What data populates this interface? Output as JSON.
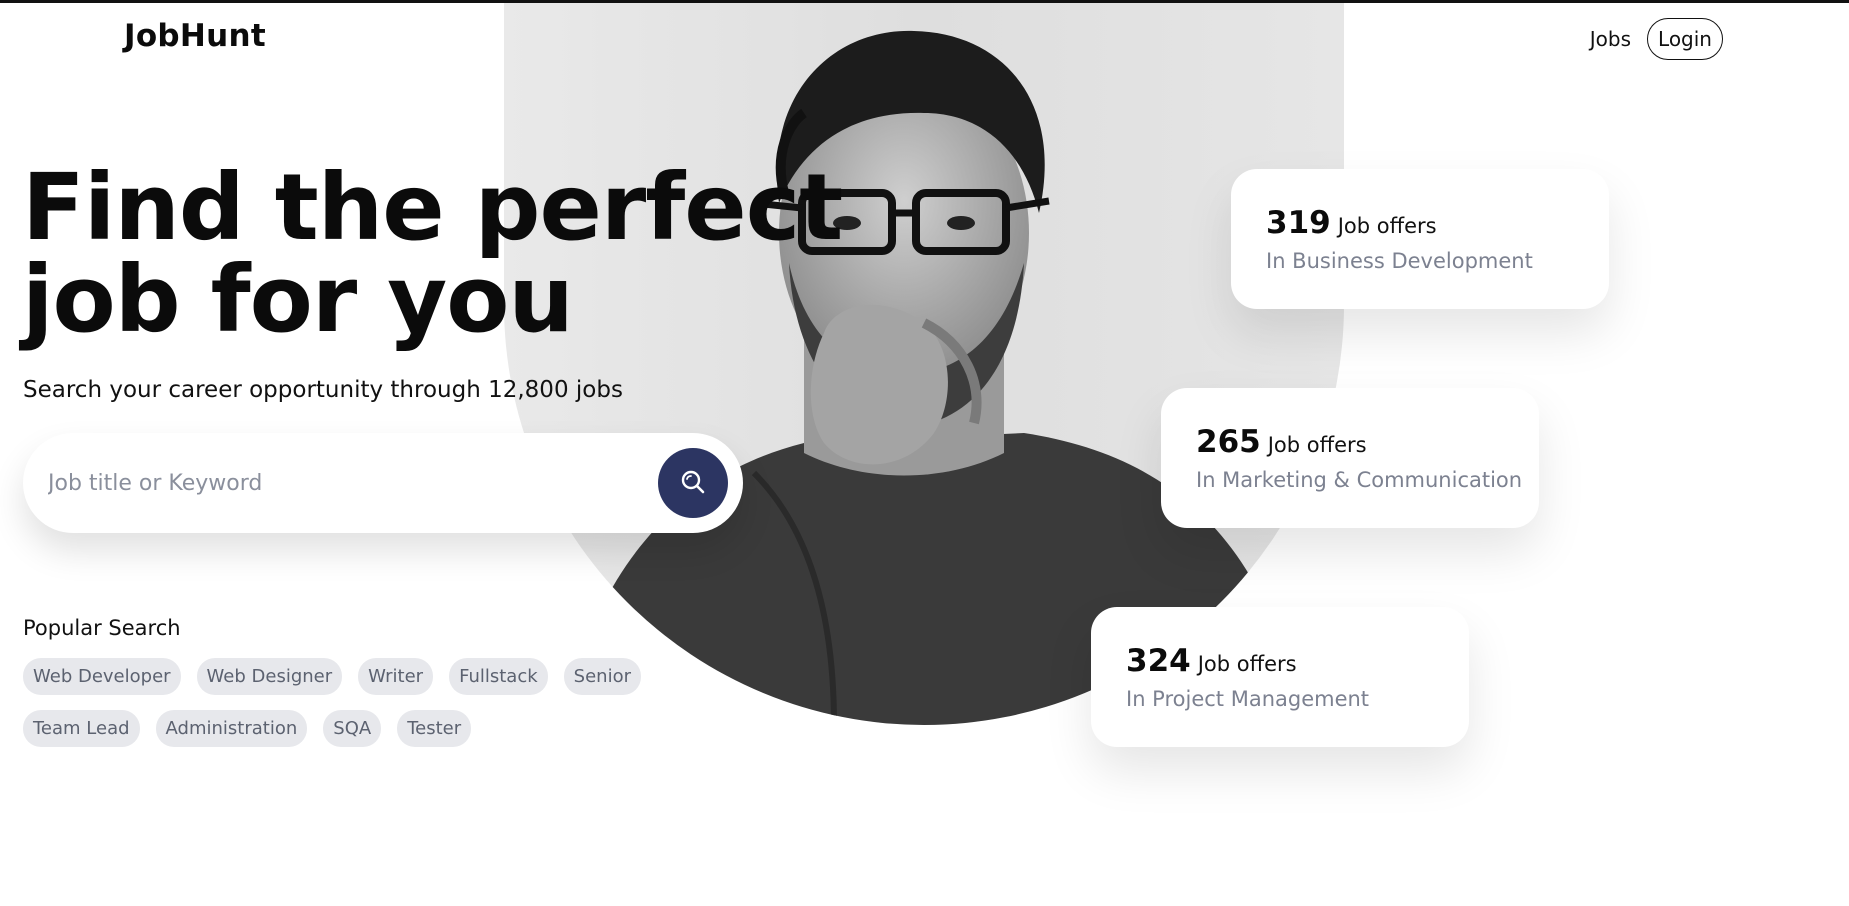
{
  "brand": {
    "name": "JobHunt"
  },
  "nav": {
    "jobs_label": "Jobs",
    "login_label": "Login"
  },
  "hero": {
    "title_line1": "Find the perfect",
    "title_line2": "job for you",
    "subtitle": "Search your career opportunity through 12,800 jobs"
  },
  "search": {
    "placeholder": "Job title or Keyword",
    "button_icon": "search-icon"
  },
  "popular": {
    "label": "Popular Search",
    "tags": [
      "Web Developer",
      "Web Designer",
      "Writer",
      "Fullstack",
      "Senior",
      "Team Lead",
      "Administration",
      "SQA",
      "Tester"
    ]
  },
  "stats": [
    {
      "count": "319",
      "unit": "Job offers",
      "category": "In Business Development"
    },
    {
      "count": "265",
      "unit": "Job offers",
      "category": "In Marketing & Communication"
    },
    {
      "count": "324",
      "unit": "Job offers",
      "category": "In Project Management"
    }
  ],
  "colors": {
    "accent": "#2c3562",
    "tag_bg": "#e7e8ec",
    "muted_text": "#7c8190"
  }
}
